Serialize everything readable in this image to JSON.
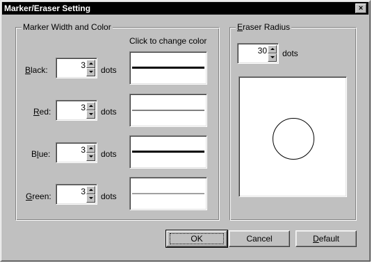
{
  "window": {
    "title": "Marker/Eraser Setting",
    "close_glyph": "×"
  },
  "marker_group": {
    "label": "Marker Width and Color",
    "color_hint": "Click to change color",
    "rows": [
      {
        "mnemonic": "B",
        "label_rest": "lack:",
        "width": "3",
        "unit": "dots",
        "line_color": "#000000",
        "line_weight": "heavy"
      },
      {
        "mnemonic_prefix": "",
        "label_pre": "",
        "mnemonic": "R",
        "label_rest": "ed:",
        "width": "3",
        "unit": "dots",
        "line_color": "#808080",
        "line_weight": "light"
      },
      {
        "label_pre": "B",
        "mnemonic": "l",
        "label_rest": "ue:",
        "width": "3",
        "unit": "dots",
        "line_color": "#000000",
        "line_weight": "heavy"
      },
      {
        "mnemonic": "G",
        "label_rest": "reen:",
        "width": "3",
        "unit": "dots",
        "line_color": "#a0a0a0",
        "line_weight": "light"
      }
    ]
  },
  "eraser_group": {
    "label_mnemonic": "E",
    "label_rest": "raser Radius",
    "radius": "30",
    "unit": "dots"
  },
  "buttons": {
    "ok": "OK",
    "cancel": "Cancel",
    "default_mnemonic": "D",
    "default_rest": "efault"
  },
  "colors": {
    "face": "#c0c0c0",
    "titlebar": "#000000"
  }
}
